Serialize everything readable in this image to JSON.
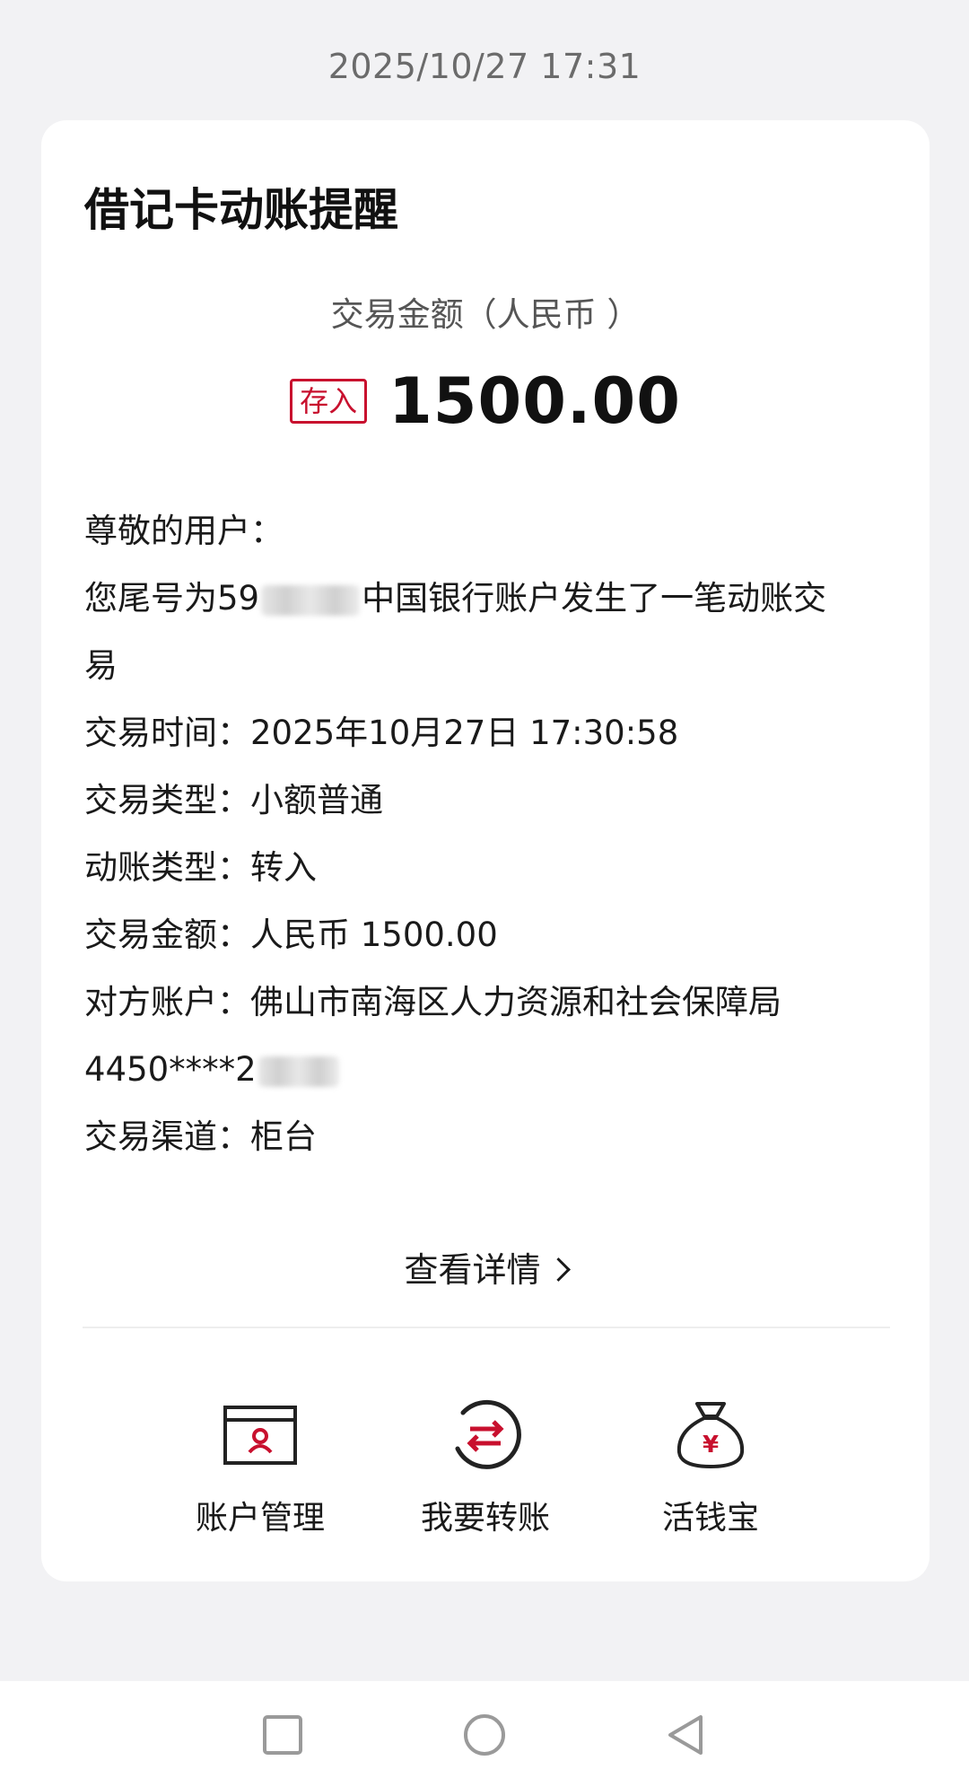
{
  "header": {
    "timestamp": "2025/10/27 17:31"
  },
  "card": {
    "title": "借记卡动账提醒",
    "amount_label": "交易金额（人民币 ）",
    "badge": "存入",
    "amount": "1500.00",
    "greeting": "尊敬的用户：",
    "message_prefix": "您尾号为59",
    "message_suffix": "中国银行账户发生了一笔动账交",
    "message_line2": "易",
    "details": [
      {
        "label": "交易时间：",
        "value": "2025年10月27日 17:30:58"
      },
      {
        "label": "交易类型：",
        "value": "小额普通"
      },
      {
        "label": "动账类型：",
        "value": "转入"
      },
      {
        "label": "交易金额：",
        "value": "人民币 1500.00"
      },
      {
        "label": "对方账户：",
        "value": "佛山市南海区人力资源和社会保障局"
      }
    ],
    "account_number_prefix": "4450****2",
    "channel": {
      "label": "交易渠道：",
      "value": "柜台"
    },
    "view_details": "查看详情"
  },
  "actions": [
    {
      "label": "账户管理",
      "icon": "account-card-icon"
    },
    {
      "label": "我要转账",
      "icon": "transfer-icon"
    },
    {
      "label": "活钱宝",
      "icon": "money-bag-icon"
    }
  ],
  "colors": {
    "accent": "#c8102e",
    "background": "#f2f2f4"
  }
}
